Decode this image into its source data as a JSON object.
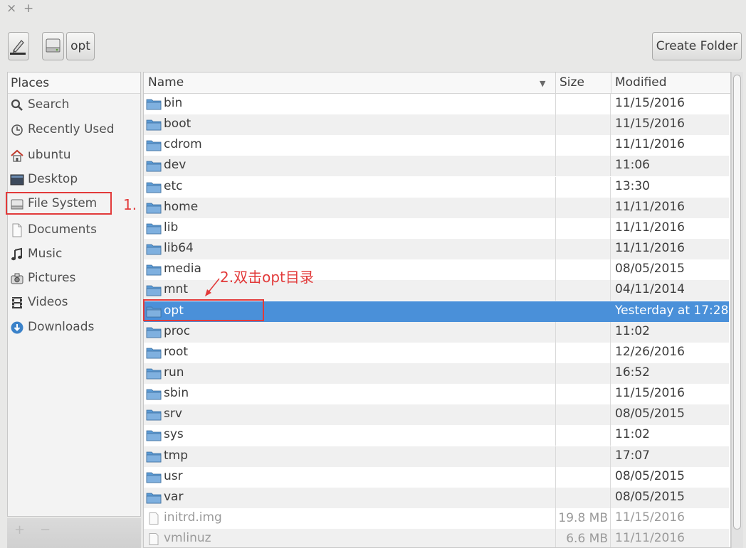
{
  "window": {
    "close_glyph": "×",
    "add_glyph": "+"
  },
  "toolbar": {
    "edit_icon": "pencil-icon",
    "drive_icon": "drive-icon",
    "path_label": "opt",
    "create_folder_label": "Create Folder"
  },
  "places": {
    "header": "Places",
    "items": [
      {
        "label": "Search",
        "icon": "search-icon"
      },
      {
        "label": "Recently Used",
        "icon": "recent-icon"
      },
      {
        "label": "ubuntu",
        "icon": "home-icon"
      },
      {
        "label": "Desktop",
        "icon": "desktop-icon"
      },
      {
        "label": "File System",
        "icon": "drive-icon"
      },
      {
        "label": "Documents",
        "icon": "document-icon"
      },
      {
        "label": "Music",
        "icon": "music-icon"
      },
      {
        "label": "Pictures",
        "icon": "pictures-icon"
      },
      {
        "label": "Videos",
        "icon": "video-icon"
      },
      {
        "label": "Downloads",
        "icon": "download-icon"
      }
    ],
    "add_glyph": "+",
    "remove_glyph": "−"
  },
  "file_list": {
    "columns": {
      "name": "Name",
      "size": "Size",
      "modified": "Modified"
    },
    "sort_indicator": "▼",
    "rows": [
      {
        "name": "bin",
        "size": "",
        "modified": "11/15/2016",
        "type": "folder"
      },
      {
        "name": "boot",
        "size": "",
        "modified": "11/15/2016",
        "type": "folder"
      },
      {
        "name": "cdrom",
        "size": "",
        "modified": "11/11/2016",
        "type": "folder"
      },
      {
        "name": "dev",
        "size": "",
        "modified": "11:06",
        "type": "folder"
      },
      {
        "name": "etc",
        "size": "",
        "modified": "13:30",
        "type": "folder"
      },
      {
        "name": "home",
        "size": "",
        "modified": "11/11/2016",
        "type": "folder"
      },
      {
        "name": "lib",
        "size": "",
        "modified": "11/11/2016",
        "type": "folder"
      },
      {
        "name": "lib64",
        "size": "",
        "modified": "11/11/2016",
        "type": "folder"
      },
      {
        "name": "media",
        "size": "",
        "modified": "08/05/2015",
        "type": "folder"
      },
      {
        "name": "mnt",
        "size": "",
        "modified": "04/11/2014",
        "type": "folder"
      },
      {
        "name": "opt",
        "size": "",
        "modified": "Yesterday at 17:28",
        "type": "folder",
        "selected": true
      },
      {
        "name": "proc",
        "size": "",
        "modified": "11:02",
        "type": "folder"
      },
      {
        "name": "root",
        "size": "",
        "modified": "12/26/2016",
        "type": "folder"
      },
      {
        "name": "run",
        "size": "",
        "modified": "16:52",
        "type": "folder"
      },
      {
        "name": "sbin",
        "size": "",
        "modified": "11/15/2016",
        "type": "folder"
      },
      {
        "name": "srv",
        "size": "",
        "modified": "08/05/2015",
        "type": "folder"
      },
      {
        "name": "sys",
        "size": "",
        "modified": "11:02",
        "type": "folder"
      },
      {
        "name": "tmp",
        "size": "",
        "modified": "17:07",
        "type": "folder"
      },
      {
        "name": "usr",
        "size": "",
        "modified": "08/05/2015",
        "type": "folder"
      },
      {
        "name": "var",
        "size": "",
        "modified": "08/05/2015",
        "type": "folder"
      },
      {
        "name": "initrd.img",
        "size": "19.8 MB",
        "modified": "11/15/2016",
        "type": "file"
      },
      {
        "name": "vmlinuz",
        "size": "6.6 MB",
        "modified": "11/11/2016",
        "type": "file"
      }
    ]
  },
  "annotations": {
    "step1": "1.",
    "step2": "2.双击opt目录"
  },
  "colors": {
    "selection": "#4a90d9",
    "annotation": "#e23a3a",
    "folder": "#5b9bd5"
  }
}
